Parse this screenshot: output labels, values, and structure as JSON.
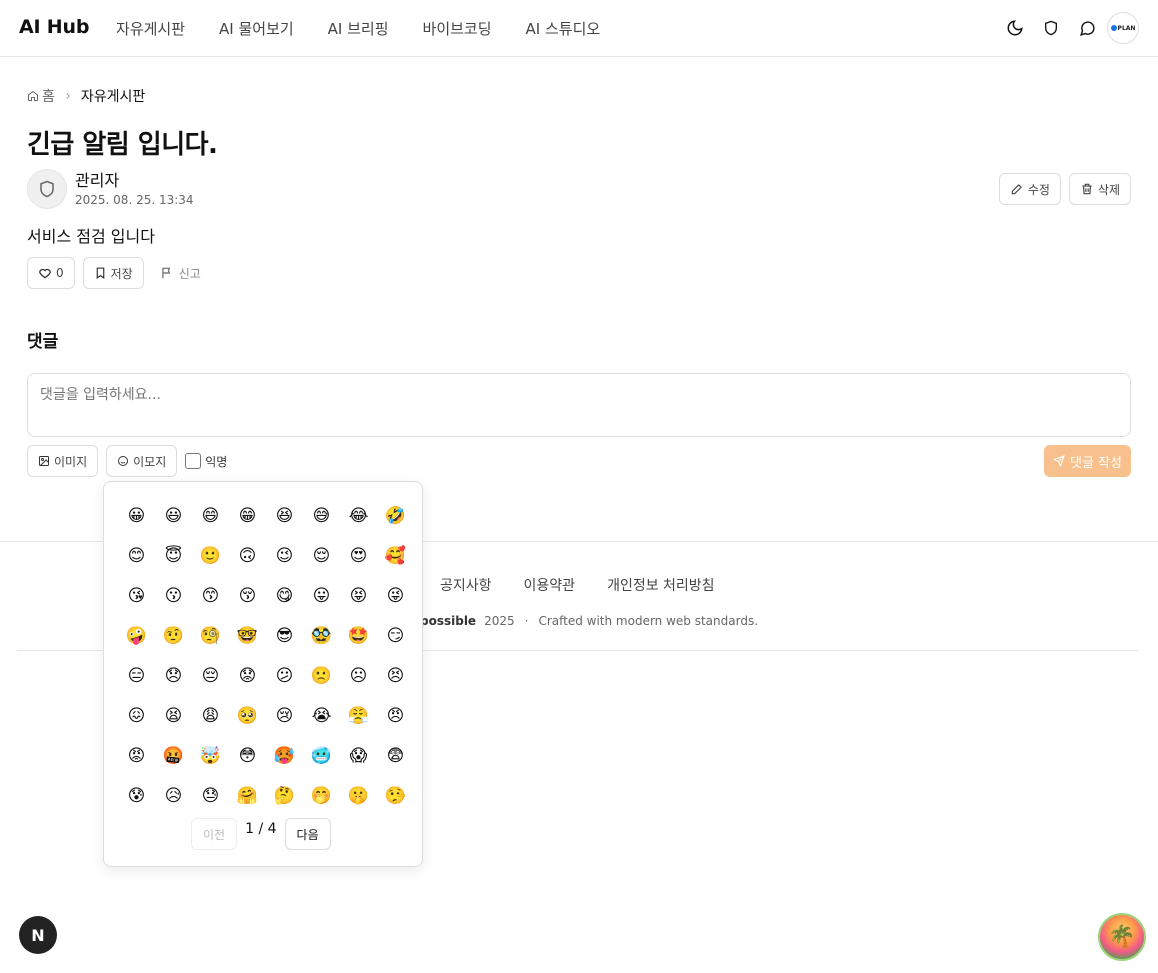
{
  "header": {
    "logo": "AI Hub",
    "nav": [
      "자유게시판",
      "AI 물어보기",
      "AI 브리핑",
      "바이브코딩",
      "AI 스튜디오"
    ],
    "plan_badge": "PLAN",
    "icons": [
      "moon-icon",
      "shield-icon",
      "chat-icon"
    ]
  },
  "breadcrumb": {
    "home": "홈",
    "current": "자유게시판"
  },
  "post": {
    "title": "긴급 알림 입니다.",
    "author": "관리자",
    "date": "2025. 08. 25. 13:34",
    "edit_label": "수정",
    "delete_label": "삭제",
    "body": "서비스 점검 입니다",
    "like_count": "0",
    "save_label": "저장",
    "report_label": "신고"
  },
  "comments": {
    "title": "댓글",
    "placeholder": "댓글을 입력하세요...",
    "image_label": "이미지",
    "emoji_label": "이모지",
    "anon_label": "익명",
    "submit_label": "댓글 작성"
  },
  "emoji_picker": {
    "emojis": [
      "😀",
      "😃",
      "😄",
      "😁",
      "😆",
      "😅",
      "😂",
      "🤣",
      "😊",
      "😇",
      "🙂",
      "🙃",
      "😉",
      "😌",
      "😍",
      "🥰",
      "😘",
      "😗",
      "😙",
      "😚",
      "😋",
      "😛",
      "😝",
      "😜",
      "🤪",
      "🤨",
      "🧐",
      "🤓",
      "😎",
      "🥸",
      "🤩",
      "😏",
      "😑",
      "😞",
      "😔",
      "😟",
      "😕",
      "🙁",
      "☹",
      "😣",
      "😖",
      "😫",
      "😩",
      "🥺",
      "😢",
      "😭",
      "😤",
      "😠",
      "😡",
      "🤬",
      "🤯",
      "😳",
      "🥵",
      "🥶",
      "😱",
      "😨",
      "😰",
      "😥",
      "😓",
      "🤗",
      "🤔",
      "🤭",
      "🤫",
      "🤥"
    ],
    "prev_label": "이전",
    "next_label": "다음",
    "page_info": "1 / 4"
  },
  "footer": {
    "links": [
      "공지사항",
      "이용약관",
      "개인정보 처리방침"
    ],
    "brand": "possible",
    "year": "2025",
    "separator": "·",
    "tagline": "Crafted with modern web standards."
  },
  "floating": {
    "nx_label": "N",
    "fab_icon": "🌴"
  }
}
